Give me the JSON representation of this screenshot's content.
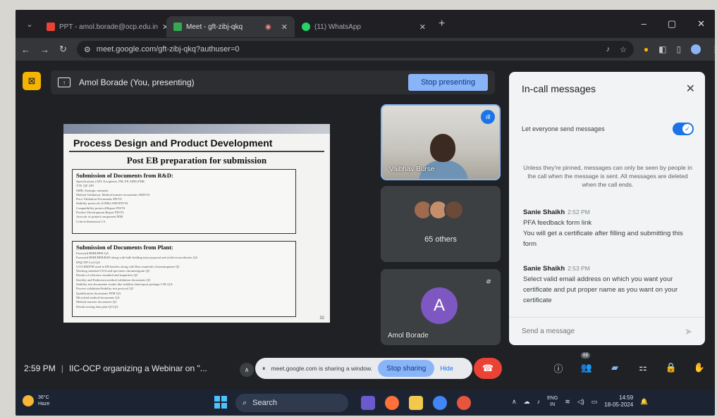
{
  "browser": {
    "tabs": [
      {
        "label": "PPT - amol.borade@ocp.edu.in",
        "favicon_color": "#ea4335",
        "active": false
      },
      {
        "label": "Meet - gft-zibj-qkq",
        "favicon_color": "#34a853",
        "active": true
      },
      {
        "label": "(11) WhatsApp",
        "favicon_color": "#25d366",
        "active": false
      }
    ],
    "url": "meet.google.com/gft-zibj-qkq?authuser=0"
  },
  "meet": {
    "presenter_label": "Amol Borade (You, presenting)",
    "stop_presenting": "Stop presenting",
    "slide": {
      "title": "Process Design and Product Development",
      "subtitle": "Post EB preparation for submission",
      "box1_heading": "Submission of Documents from  R&D:",
      "box1_lines": [
        "Specifications (API, Excipients, PM, FP, ABD) PDR",
        "TTF, QP, API",
        "SMR, Strategic rationale",
        "Method Validation, Method transfer documents ARD/TS",
        "Prior Validation Documents PD/TS",
        "Stability protocols (LIMS) ARD/PD/TS",
        "Compatibility protocol/Report PD/TS",
        "Product Development Report PD/TS",
        "Artwork of printed component PDR",
        "Critical dimension CA"
      ],
      "box2_heading": "Submission of Documents from  Plant:",
      "box2_lines": [
        "Executed BMR/BPR QA",
        "Executed BMR/BPR/RSD along with bulk holding time proposal and yield reconciliation QA",
        "IPQC/FP CoA QA",
        "COA RM/PM used in EB batches along with Raw materials chromatograms QC",
        "Working standard COA and specimen chromatogram QC",
        "Details of reference standard and impurities QC",
        "Sterility and Endotoxin method validation documents QC",
        "Stability test documents results like stability data/report package CNL/QA",
        "Process validation/Stability test protocol QC",
        "Qualification documents FPM QA",
        "Microbial method documents QA",
        "Method transfer documents QC",
        "Details testing data plan QC/QA"
      ],
      "page_number": "32"
    },
    "participants": [
      {
        "name": "Vaibhav Burse"
      },
      {
        "name": "65 others"
      },
      {
        "name": "Amol Borade",
        "initial": "A"
      }
    ],
    "chat": {
      "title": "In-call messages",
      "toggle_label": "Let everyone send messages",
      "notice": "Unless they're pinned, messages can only be seen by people in the call when the message is sent. All messages are deleted when the call ends.",
      "messages": [
        {
          "sender": "Sanie Shaikh",
          "time": "2:52 PM",
          "lines": [
            "PFA feedback form link",
            "You will get a certificate after filling and submitting this form"
          ]
        },
        {
          "sender": "Sanie Shaikh",
          "time": "2:53 PM",
          "lines": [
            "Select valid email address on which you want your certificate and put proper name as you want on your certificate"
          ]
        }
      ],
      "input_placeholder": "Send a message"
    },
    "bottom": {
      "time": "2:59 PM",
      "meeting_title": "IIC-OCP organizing a Webinar on \"...",
      "share_text": "meet.google.com is sharing a window.",
      "stop_sharing": "Stop sharing",
      "hide": "Hide",
      "people_count": "68"
    }
  },
  "taskbar": {
    "weather_temp": "36°C",
    "weather_desc": "Haze",
    "search_label": "Search",
    "lang_top": "ENG",
    "lang_bottom": "IN",
    "clock_time": "14:59",
    "clock_date": "18-05-2024"
  },
  "colors": {
    "accent_blue": "#8ab4f8",
    "end_call_red": "#ea4335",
    "present_yellow": "#f4b400"
  }
}
